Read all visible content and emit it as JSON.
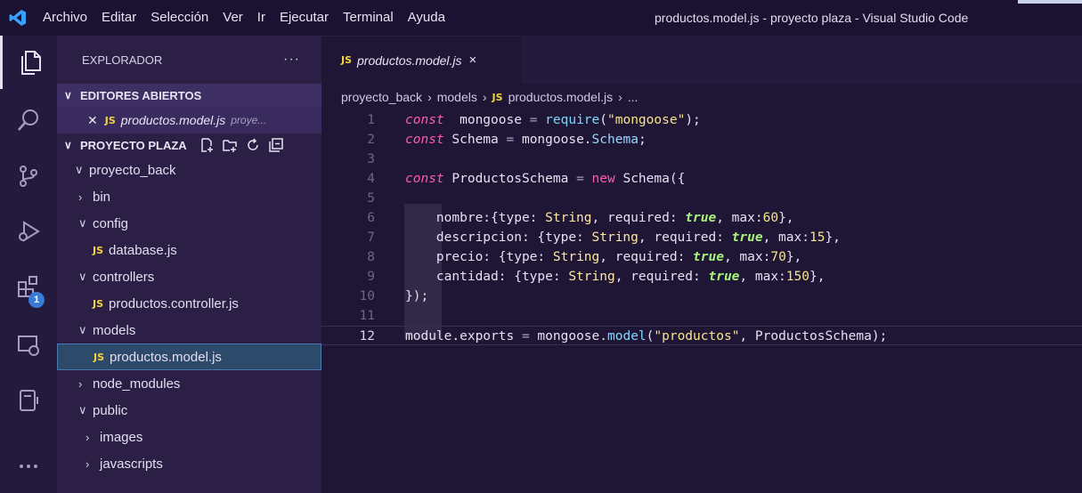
{
  "window": {
    "title": "productos.model.js - proyecto plaza - Visual Studio Code",
    "menu": [
      "Archivo",
      "Editar",
      "Selección",
      "Ver",
      "Ir",
      "Ejecutar",
      "Terminal",
      "Ayuda"
    ]
  },
  "activity_bar": {
    "icons": [
      "explorer-icon",
      "search-icon",
      "source-control-icon",
      "run-debug-icon",
      "extensions-icon",
      "remote-explorer-icon",
      "notebook-icon",
      "more-icon"
    ],
    "extensions_badge": "1"
  },
  "sidebar": {
    "header": "EXPLORADOR",
    "more": "···",
    "open_editors": {
      "title": "EDITORES ABIERTOS",
      "file_badge": "JS",
      "file_name": "productos.model.js",
      "file_dir": "proye..."
    },
    "project": {
      "title": "PROYECTO PLAZA",
      "tree": [
        {
          "label": "proyecto_back",
          "chev": "∨",
          "indent": 1,
          "js": false
        },
        {
          "label": "bin",
          "chev": "›",
          "indent": 2,
          "js": false
        },
        {
          "label": "config",
          "chev": "∨",
          "indent": 2,
          "js": false
        },
        {
          "label": "database.js",
          "chev": "",
          "indent": 3,
          "js": true
        },
        {
          "label": "controllers",
          "chev": "∨",
          "indent": 2,
          "js": false
        },
        {
          "label": "productos.controller.js",
          "chev": "",
          "indent": 3,
          "js": true
        },
        {
          "label": "models",
          "chev": "∨",
          "indent": 2,
          "js": false
        },
        {
          "label": "productos.model.js",
          "chev": "",
          "indent": 3,
          "js": true,
          "selected": true
        },
        {
          "label": "node_modules",
          "chev": "›",
          "indent": 2,
          "js": false
        },
        {
          "label": "public",
          "chev": "∨",
          "indent": 2,
          "js": false
        },
        {
          "label": "images",
          "chev": "›",
          "indent": 3,
          "js": false
        },
        {
          "label": "javascripts",
          "chev": "›",
          "indent": 3,
          "js": false
        }
      ]
    }
  },
  "editor": {
    "tab": {
      "badge": "JS",
      "name": "productos.model.js",
      "close": "×"
    },
    "breadcrumb": [
      "proyecto_back",
      "models",
      "productos.model.js",
      "..."
    ],
    "breadcrumb_badge": "JS",
    "current_line": 12,
    "lines": [
      [
        [
          "kw-it",
          "const"
        ],
        [
          "",
          "  mongoose "
        ],
        [
          "op",
          "="
        ],
        [
          "",
          ""
        ],
        [
          "fn",
          " require"
        ],
        [
          "",
          "("
        ],
        [
          "str",
          "\"mongoose\""
        ],
        [
          "",
          ");"
        ]
      ],
      [
        [
          "kw-it",
          "const"
        ],
        [
          "",
          ""
        ],
        [
          "",
          " Schema "
        ],
        [
          "op",
          "="
        ],
        [
          "",
          " mongoose."
        ],
        [
          "prop",
          "Schema"
        ],
        [
          "",
          ";"
        ]
      ],
      [],
      [
        [
          "kw-it",
          "const"
        ],
        [
          "",
          " ProductosSchema "
        ],
        [
          "op",
          "="
        ],
        [
          "",
          " "
        ],
        [
          "kw",
          "new"
        ],
        [
          "",
          " Schema({"
        ]
      ],
      [],
      [
        [
          "",
          "    nombre:{type: "
        ],
        [
          "type",
          "String"
        ],
        [
          "",
          ", required: "
        ],
        [
          "bool",
          "true"
        ],
        [
          "",
          ", max:"
        ],
        [
          "num",
          "60"
        ],
        [
          "",
          "},"
        ]
      ],
      [
        [
          "",
          "    descripcion: {type: "
        ],
        [
          "type",
          "String"
        ],
        [
          "",
          ", required: "
        ],
        [
          "bool",
          "true"
        ],
        [
          "",
          ", max:"
        ],
        [
          "num",
          "15"
        ],
        [
          "",
          "},"
        ]
      ],
      [
        [
          "",
          "    precio: {type: "
        ],
        [
          "type",
          "String"
        ],
        [
          "",
          ", required: "
        ],
        [
          "bool",
          "true"
        ],
        [
          "",
          ", max:"
        ],
        [
          "num",
          "70"
        ],
        [
          "",
          "},"
        ]
      ],
      [
        [
          "",
          "    cantidad: {type: "
        ],
        [
          "type",
          "String"
        ],
        [
          "",
          ", required: "
        ],
        [
          "bool",
          "true"
        ],
        [
          "",
          ", max:"
        ],
        [
          "num",
          "150"
        ],
        [
          "",
          "},"
        ]
      ],
      [
        [
          "",
          "});"
        ]
      ],
      [],
      [
        [
          "",
          "module.exports "
        ],
        [
          "op",
          "="
        ],
        [
          "",
          " mongoose."
        ],
        [
          "fn",
          "model"
        ],
        [
          "",
          "("
        ],
        [
          "str",
          "\"productos\""
        ],
        [
          "",
          ", ProductosSchema);"
        ]
      ]
    ]
  },
  "colors": {
    "accent": "#ff5bb0",
    "js_badge": "#f4d43d",
    "selection": "#2e4a6a"
  }
}
